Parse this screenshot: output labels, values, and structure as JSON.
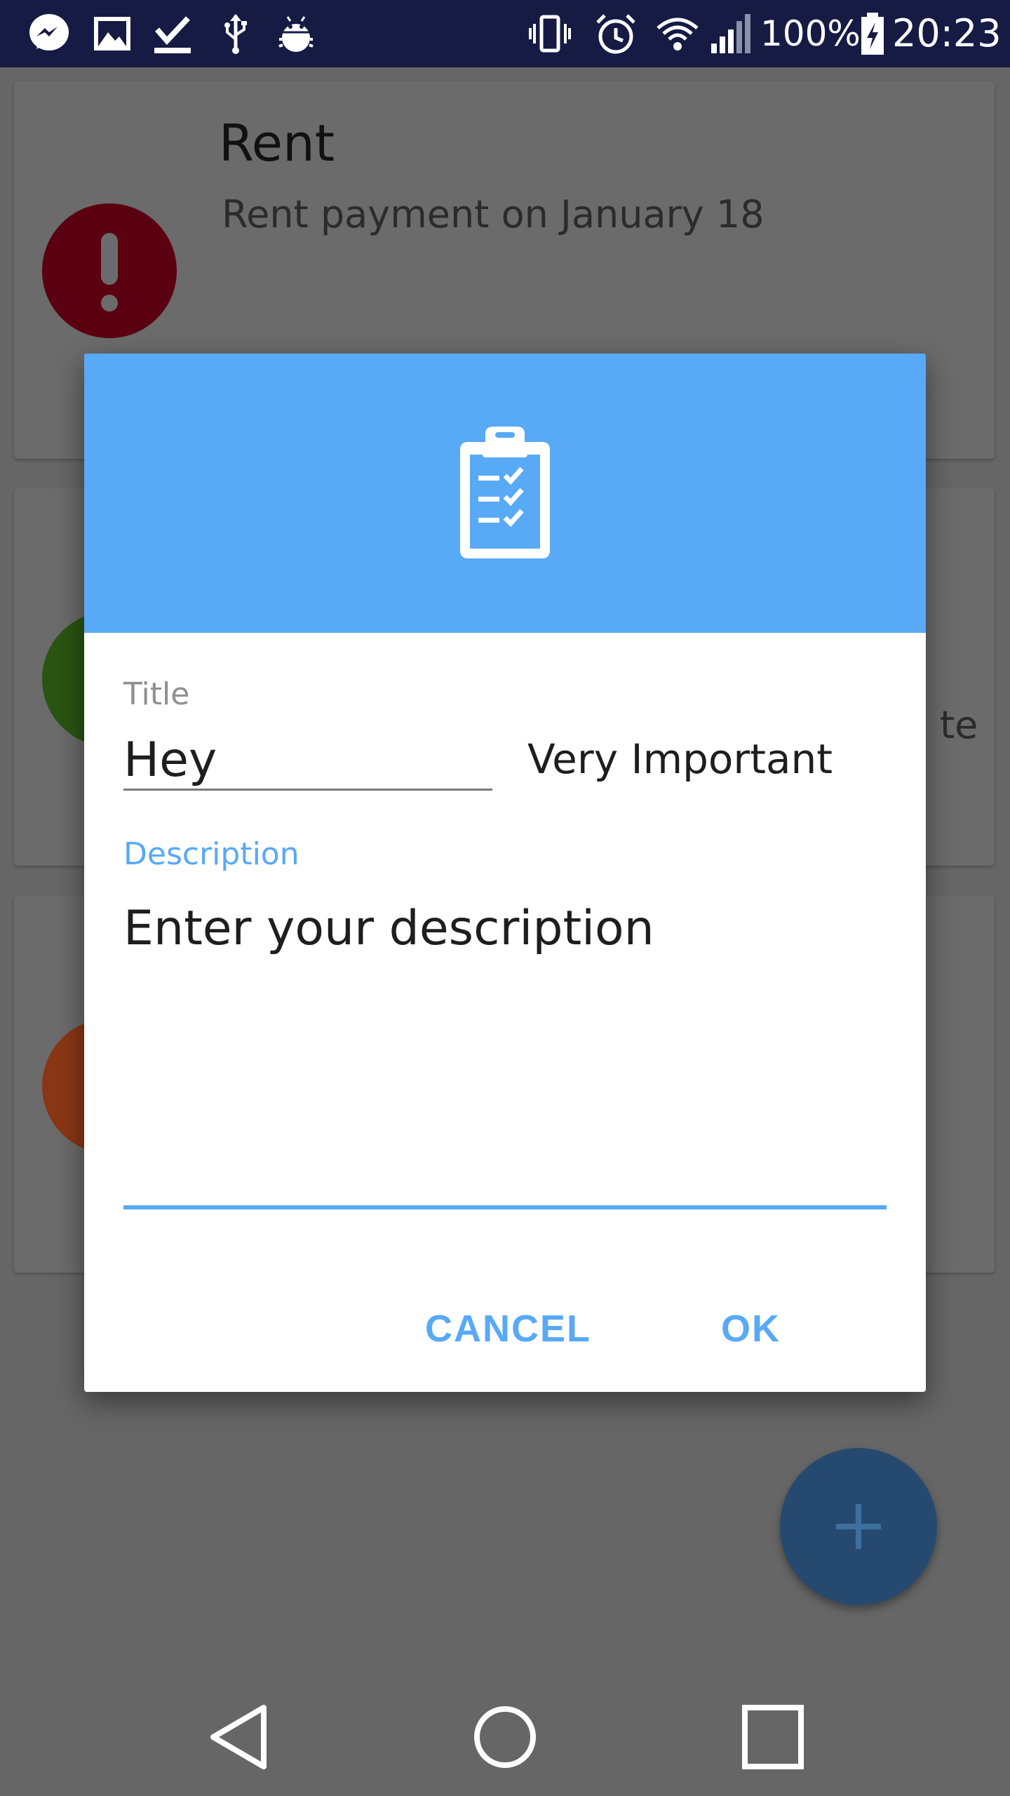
{
  "status_bar": {
    "battery_text": "100%",
    "time": "20:23",
    "left_icons": [
      "messenger-icon",
      "gallery-icon",
      "download-done-icon",
      "usb-icon",
      "android-debug-icon"
    ],
    "right_icons": [
      "vibrate-icon",
      "alarm-icon",
      "wifi-icon",
      "cell-signal-icon",
      "battery-charging-icon"
    ]
  },
  "cards": [
    {
      "title": "Rent",
      "subtitle": "Rent payment on January 18",
      "avatar_color": "#5a0011",
      "avatar_icon": "exclamation-icon"
    },
    {
      "avatar_color": "#2a5412",
      "clipped_text": "te"
    },
    {
      "avatar_color": "#8a3615"
    }
  ],
  "dialog": {
    "header_color": "#58a9f6",
    "header_icon": "clipboard-checklist-icon",
    "title_label": "Title",
    "title_value": "Hey",
    "priority_value": "Very Important",
    "description_label": "Description",
    "description_placeholder": "Enter your description",
    "cancel_label": "CANCEL",
    "ok_label": "OK"
  },
  "fab": {
    "icon": "plus-icon",
    "color": "#264a6f"
  },
  "nav_bar": {
    "icons": [
      "back-icon",
      "home-icon",
      "recents-icon"
    ]
  }
}
